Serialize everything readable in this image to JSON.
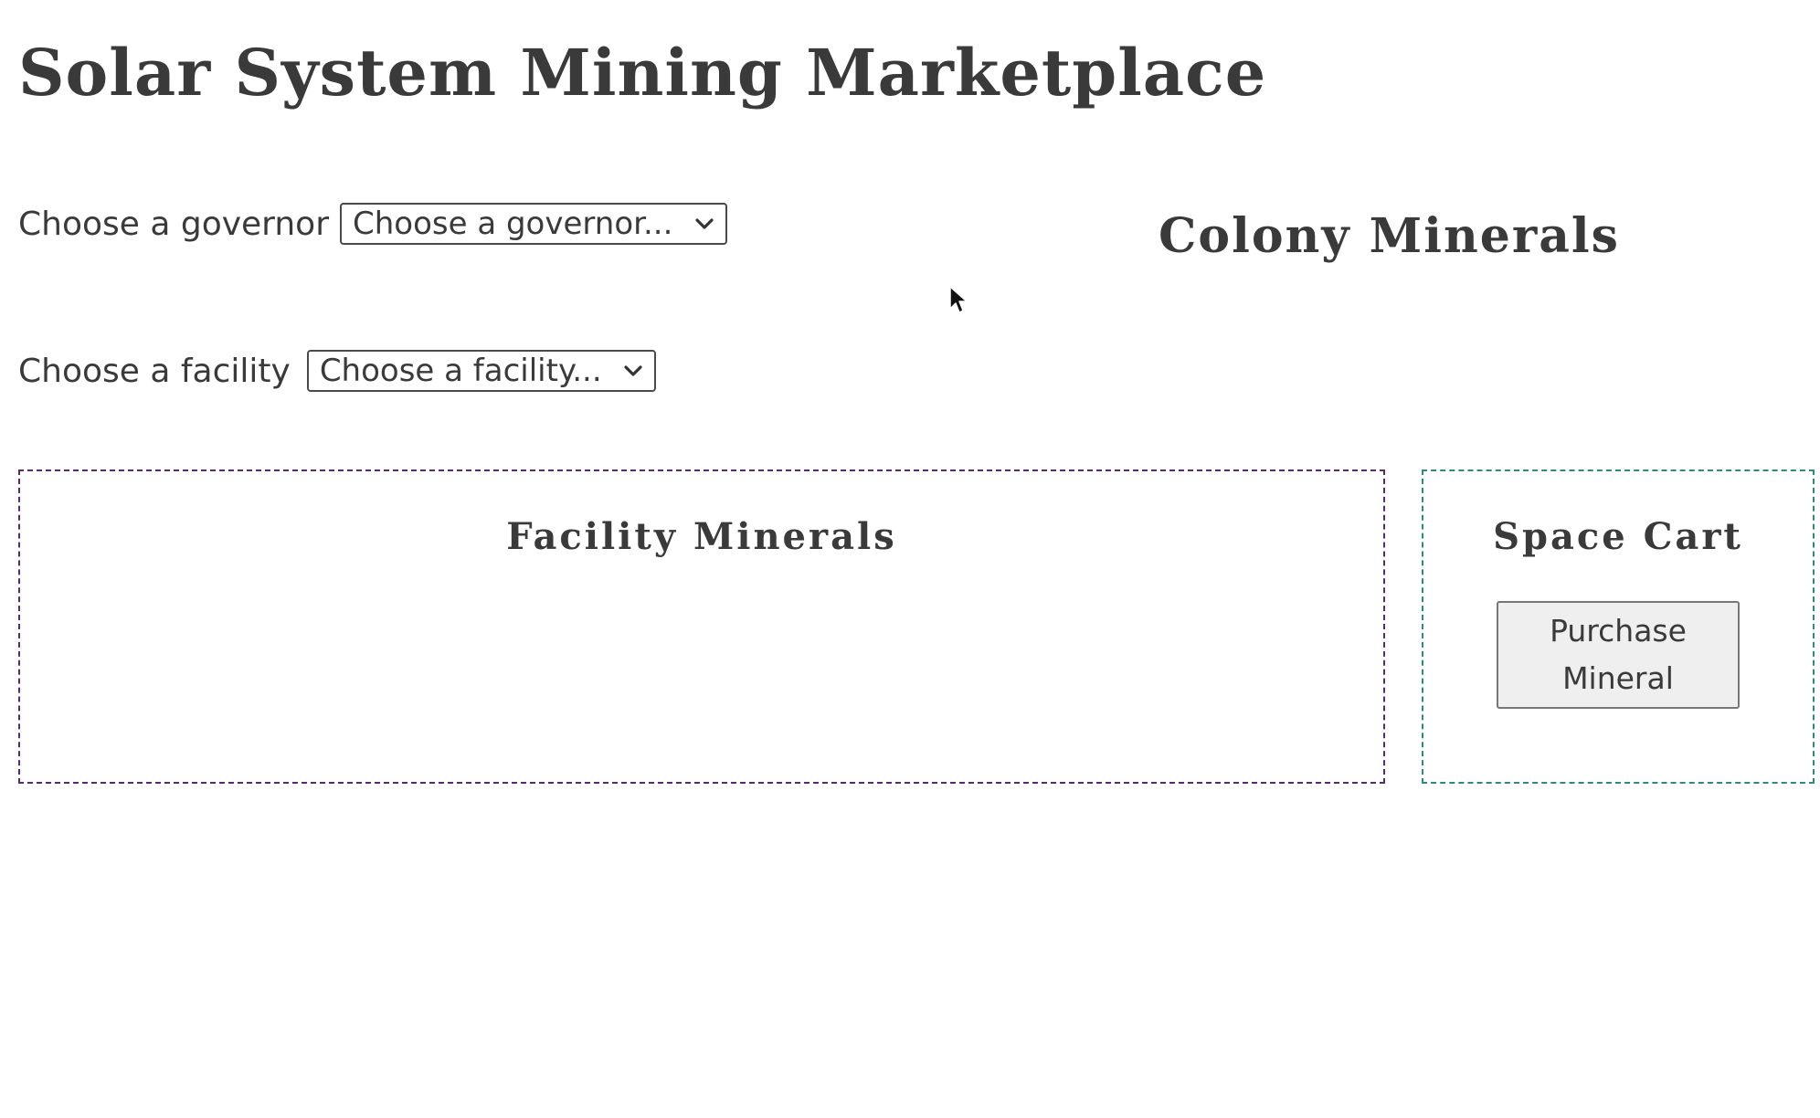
{
  "page": {
    "title": "Solar System Mining Marketplace"
  },
  "governor": {
    "label": "Choose a governor",
    "selected": "Choose a governor..."
  },
  "facility": {
    "label": "Choose a facility",
    "selected": "Choose a facility..."
  },
  "colony": {
    "title": "Colony Minerals"
  },
  "facility_minerals": {
    "title": "Facility Minerals"
  },
  "cart": {
    "title": "Space Cart",
    "purchase_label": "Purchase Mineral"
  },
  "icons": {
    "dropdown": "chevron-down-icon",
    "cursor": "mouse-pointer-icon"
  },
  "colors": {
    "text": "#3a3a3a",
    "facility_border": "#5b2a6e",
    "cart_border": "#2e8a7c",
    "button_bg": "#efefef"
  }
}
